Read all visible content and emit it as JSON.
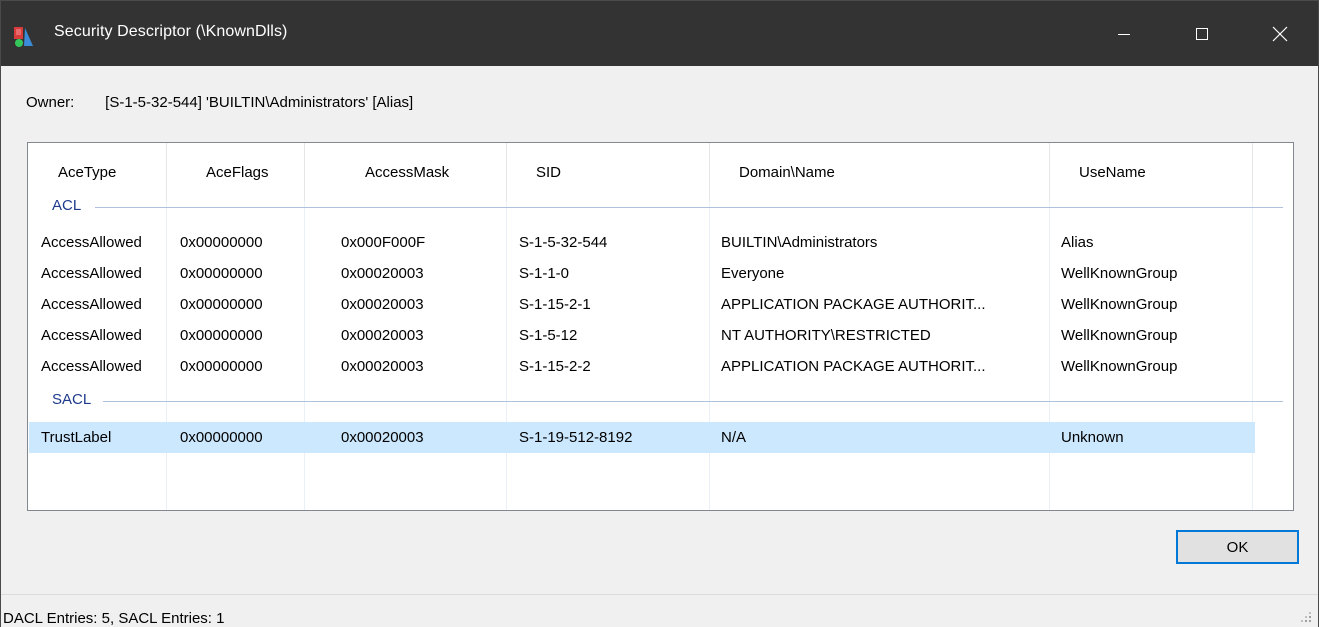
{
  "window": {
    "title": "Security Descriptor (\\KnownDlls)",
    "app_icon": "process-hacker-icon",
    "controls": {
      "minimize": "minimize-icon",
      "maximize": "maximize-icon",
      "close": "close-icon"
    }
  },
  "owner": {
    "label": "Owner:",
    "value": "[S-1-5-32-544] 'BUILTIN\\Administrators' [Alias]"
  },
  "table": {
    "columns": [
      "AceType",
      "AceFlags",
      "AccessMask",
      "SID",
      "Domain\\Name",
      "UseName"
    ],
    "groups": [
      {
        "label": "ACL",
        "rows": [
          [
            "AccessAllowed",
            "0x00000000",
            "0x000F000F",
            "S-1-5-32-544",
            "BUILTIN\\Administrators",
            "Alias"
          ],
          [
            "AccessAllowed",
            "0x00000000",
            "0x00020003",
            "S-1-1-0",
            "Everyone",
            "WellKnownGroup"
          ],
          [
            "AccessAllowed",
            "0x00000000",
            "0x00020003",
            "S-1-15-2-1",
            "APPLICATION PACKAGE AUTHORIT...",
            "WellKnownGroup"
          ],
          [
            "AccessAllowed",
            "0x00000000",
            "0x00020003",
            "S-1-5-12",
            "NT AUTHORITY\\RESTRICTED",
            "WellKnownGroup"
          ],
          [
            "AccessAllowed",
            "0x00000000",
            "0x00020003",
            "S-1-15-2-2",
            "APPLICATION PACKAGE AUTHORIT...",
            "WellKnownGroup"
          ]
        ]
      },
      {
        "label": "SACL",
        "rows": [
          [
            "TrustLabel",
            "0x00000000",
            "0x00020003",
            "S-1-19-512-8192",
            "N/A",
            "Unknown"
          ]
        ],
        "selected_row": 0
      }
    ]
  },
  "buttons": {
    "ok": "OK"
  },
  "status": {
    "text": "DACL Entries: 5, SACL Entries: 1"
  },
  "colors": {
    "titlebar": "#333333",
    "selection": "#cce8ff",
    "group_header": "#1e3a8c",
    "focus_border": "#0078d7"
  }
}
